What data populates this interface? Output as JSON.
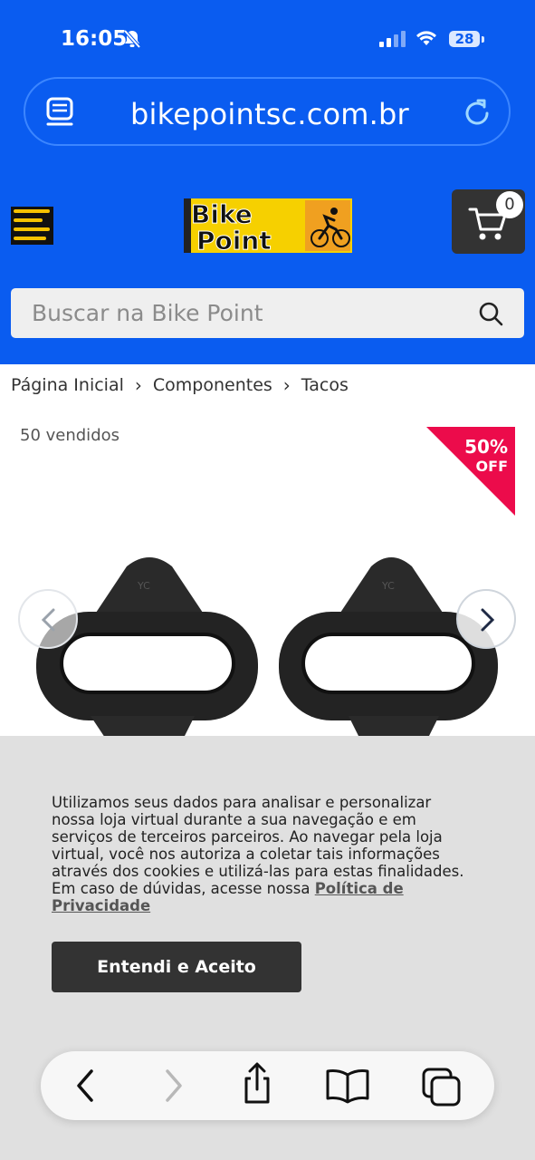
{
  "status_bar": {
    "time": "16:05",
    "battery": "28"
  },
  "browser": {
    "url": "bikepointsc.com.br"
  },
  "header": {
    "logo_line1": "Bike",
    "logo_line2": "Point",
    "cart_count": "0",
    "search_placeholder": "Buscar na Bike Point"
  },
  "breadcrumb": [
    {
      "label": "Página Inicial"
    },
    {
      "label": "Componentes"
    },
    {
      "label": "Tacos"
    }
  ],
  "product": {
    "sold_count": "50 vendidos",
    "discount_pct": "50%",
    "discount_off": "OFF",
    "cleat_marking": "YC"
  },
  "cookie_banner": {
    "text": "Utilizamos seus dados para analisar e personalizar nossa loja virtual durante a sua navegação e em serviços de terceiros parceiros. Ao navegar pela loja virtual, você nos autoriza a coletar tais informações através dos cookies e utilizá-las para estas finalidades. Em caso de dúvidas, acesse nossa ",
    "link_label": "Política de Privacidade",
    "accept_label": "Entendi e Aceito"
  },
  "colors": {
    "brand_blue": "#0a5cf0",
    "logo_yellow": "#f6d000",
    "badge_red": "#ec0b4b",
    "cart_bg": "#333333"
  },
  "icons": [
    "bell-muted-icon",
    "signal-icon",
    "wifi-icon",
    "reader-icon",
    "reload-icon",
    "menu-icon",
    "cart-icon",
    "search-icon",
    "chevron-right-icon",
    "back-icon",
    "forward-icon",
    "share-icon",
    "bookmarks-icon",
    "tabs-icon"
  ]
}
